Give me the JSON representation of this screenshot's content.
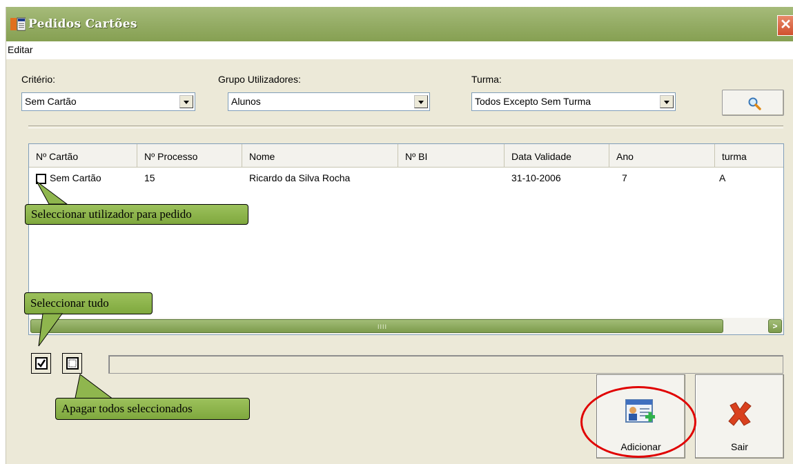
{
  "window": {
    "title": "Pedidos Cartões",
    "close_symbol": "✕"
  },
  "menu": {
    "items": [
      "Editar"
    ]
  },
  "filters": {
    "criterio": {
      "label": "Critério:",
      "value": "Sem Cartão"
    },
    "grupo": {
      "label": "Grupo Utilizadores:",
      "value": "Alunos"
    },
    "turma": {
      "label": "Turma:",
      "value": "Todos Excepto Sem Turma"
    }
  },
  "table": {
    "columns": [
      "Nº Cartão",
      "Nº Processo",
      "Nome",
      "Nº BI",
      "Data Validade",
      "Ano",
      "turma"
    ],
    "rows": [
      {
        "cartao": "Sem Cartão",
        "processo": "15",
        "nome": "Ricardo da Silva Rocha",
        "bi": "",
        "validade": "31-10-2006",
        "ano": "7",
        "turma": "A",
        "checked": false
      }
    ]
  },
  "scrollbar": {
    "grip": "IIII",
    "right_arrow": ">"
  },
  "buttons": {
    "adicionar": "Adicionar",
    "sair": "Sair"
  },
  "callouts": {
    "select_user": "Seleccionar utilizador para pedido",
    "select_all": "Seleccionar tudo",
    "clear_all": "Apagar todos seleccionados"
  },
  "icons": {
    "title": "form-window-icon",
    "search": "magnifier-icon",
    "select_all": "checked-box-icon",
    "clear_all": "empty-box-icon",
    "adicionar": "add-user-card-icon",
    "sair": "red-x-icon"
  },
  "colors": {
    "titlebar": "#93ab63",
    "callout": "#8fb64e",
    "highlight_ring": "#e00000",
    "exit_icon": "#d9411e"
  }
}
